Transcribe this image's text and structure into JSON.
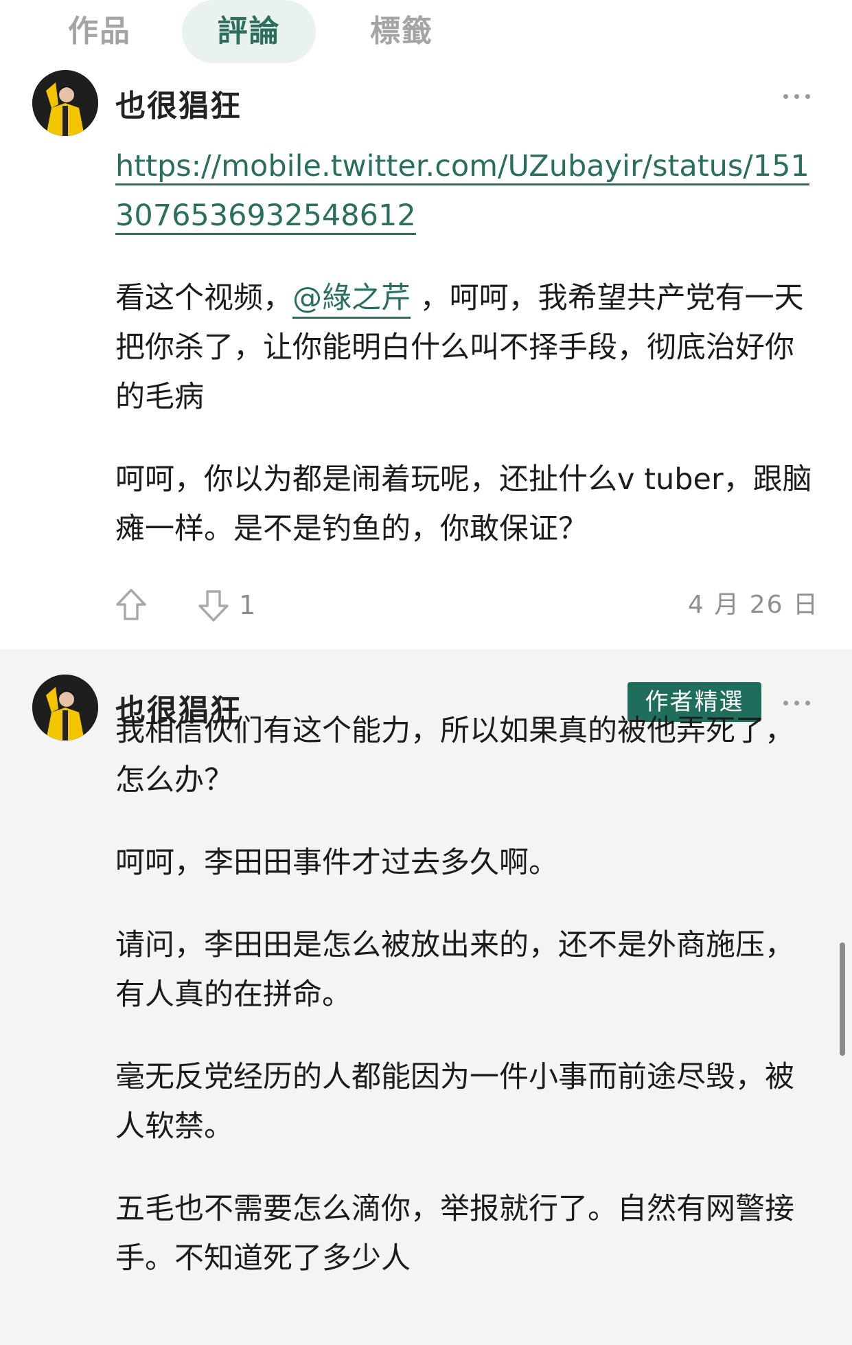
{
  "tabs": [
    {
      "label": "作品",
      "active": false
    },
    {
      "label": "評論",
      "active": true
    },
    {
      "label": "標籤",
      "active": false
    }
  ],
  "comments": [
    {
      "username": "也很猖狂",
      "link": "https://mobile.twitter.com/UZubayir/status/1513076536932548612",
      "paragraphs": [
        {
          "before": "看这个视频，",
          "mention": "@綠之芹",
          "after": " ，呵呵，我希望共产党有一天把你杀了，让你能明白什么叫不择手段，彻底治好你的毛病"
        },
        {
          "text": "呵呵，你以为都是闹着玩呢，还扯什么v tuber，跟脑瘫一样。是不是钓鱼的，你敢保证？"
        }
      ],
      "downvote_count": "1",
      "date": "4 月 26 日"
    },
    {
      "username": "也很猖狂",
      "badge": "作者精選",
      "paragraphs": [
        {
          "text": "我相信伙们有这个能力，所以如果真的被他弄死了，怎么办？"
        },
        {
          "text": "呵呵，李田田事件才过去多久啊。"
        },
        {
          "text": "请问，李田田是怎么被放出来的，还不是外商施压，有人真的在拼命。"
        },
        {
          "text": "毫无反党经历的人都能因为一件小事而前途尽毁，被人软禁。"
        },
        {
          "text": "五毛也不需要怎么滴你，举报就行了。自然有网警接手。不知道死了多少人"
        }
      ]
    }
  ],
  "icons": {
    "upvote": "upvote-arrow-icon",
    "downvote": "downvote-arrow-icon",
    "more": "more-dots-icon"
  },
  "colors": {
    "accent": "#2a6e5d",
    "badge": "#1f6e5c",
    "active_tab_bg": "#eaf2ef",
    "second_comment_bg": "#f4f4f4"
  }
}
